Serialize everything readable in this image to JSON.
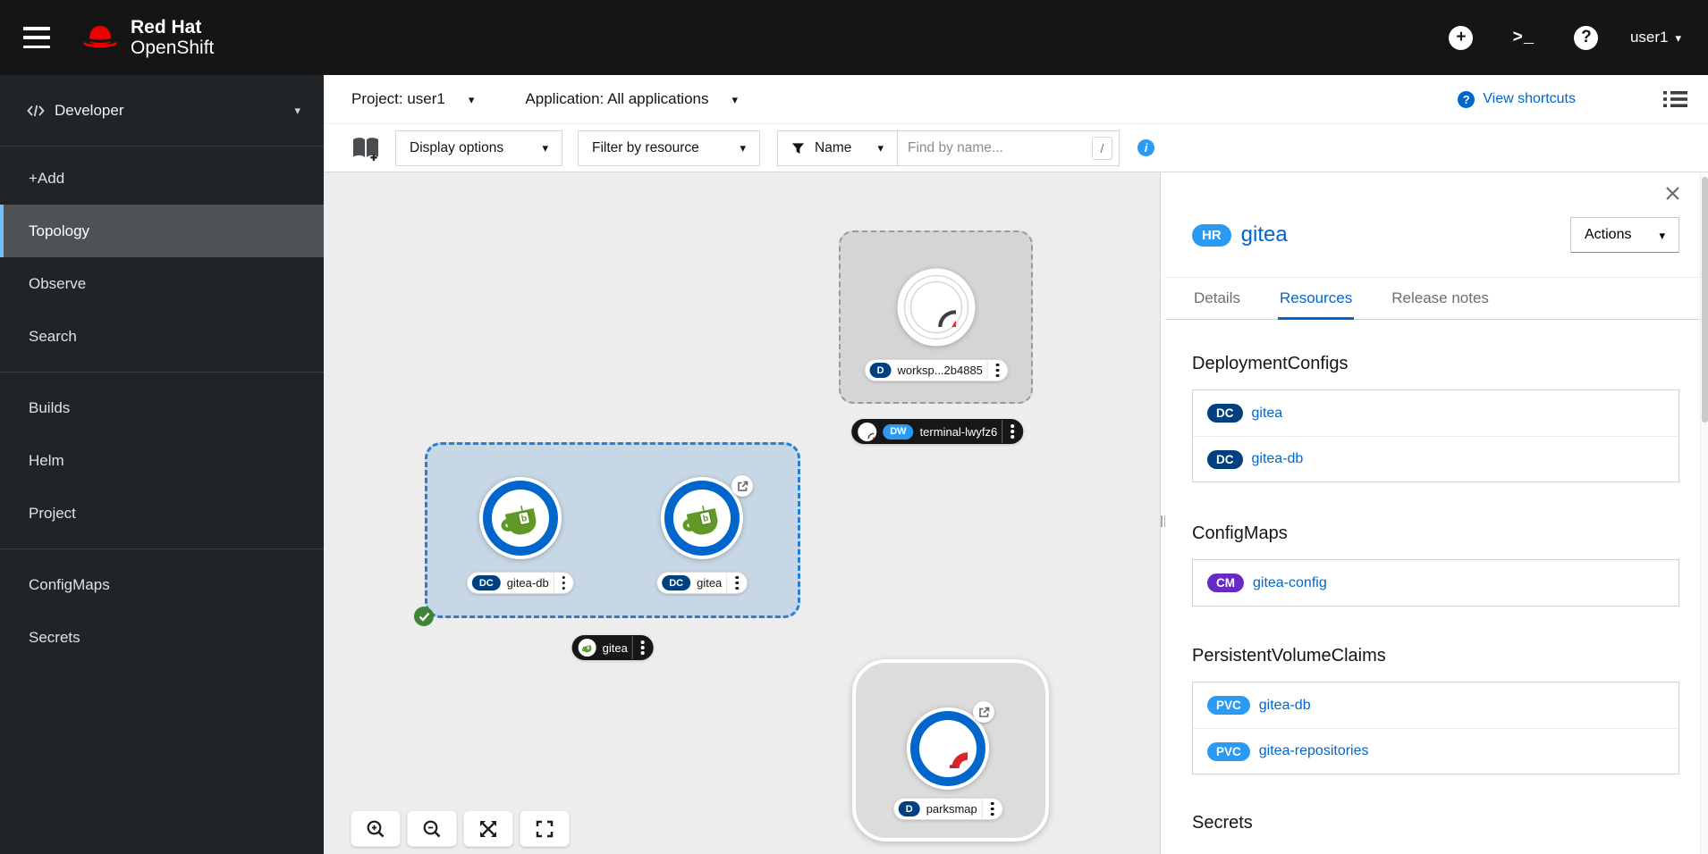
{
  "masthead": {
    "brand_top": "Red Hat",
    "brand_bottom": "OpenShift",
    "user_menu": "user1"
  },
  "sidenav": {
    "perspective": "Developer",
    "items": [
      "+Add",
      "Topology",
      "Observe",
      "Search",
      "Builds",
      "Helm",
      "Project",
      "ConfigMaps",
      "Secrets"
    ],
    "active_item": "Topology"
  },
  "toolbar": {
    "project": "Project: user1",
    "application": "Application: All applications",
    "view_shortcuts": "View shortcuts"
  },
  "filterbar": {
    "display_options": "Display options",
    "filter_by_resource": "Filter by resource",
    "name_filter": "Name",
    "find_placeholder": "Find by name...",
    "slash_hint": "/"
  },
  "canvas": {
    "workspace_node": {
      "badge": "D",
      "name": "worksp...2b4885"
    },
    "terminal_pill": {
      "badge": "DW",
      "name": "terminal-lwyfz6"
    },
    "app_group": {
      "nodes": [
        {
          "badge": "DC",
          "name": "gitea-db"
        },
        {
          "badge": "DC",
          "name": "gitea"
        }
      ],
      "app_pill": {
        "name": "gitea"
      }
    },
    "parksmap_node": {
      "badge": "D",
      "name": "parksmap"
    }
  },
  "panel": {
    "resource_badge": "HR",
    "title": "gitea",
    "actions": "Actions",
    "tabs": [
      "Details",
      "Resources",
      "Release notes"
    ],
    "active_tab": "Resources",
    "sections": [
      {
        "heading": "DeploymentConfigs",
        "items": [
          {
            "badge": "DC",
            "name": "gitea"
          },
          {
            "badge": "DC",
            "name": "gitea-db"
          }
        ]
      },
      {
        "heading": "ConfigMaps",
        "items": [
          {
            "badge": "CM",
            "name": "gitea-config"
          }
        ]
      },
      {
        "heading": "PersistentVolumeClaims",
        "items": [
          {
            "badge": "PVC",
            "name": "gitea-db"
          },
          {
            "badge": "PVC",
            "name": "gitea-repositories"
          }
        ]
      },
      {
        "heading": "Secrets",
        "items": []
      }
    ]
  },
  "icons": {
    "plus": "+",
    "terminal": ">_",
    "help": "?",
    "question": "?",
    "info": "i",
    "caret_down": "▾"
  },
  "colors": {
    "masthead_bg": "#151515",
    "nav_bg": "#212427",
    "nav_selected_bg": "#4f5255",
    "nav_selected_border": "#73bcf7",
    "link_blue": "#0066cc",
    "light_blue_badge": "#2b9af3",
    "navy_badge": "#004080",
    "purple_badge": "#6929c4",
    "brand_red": "#ee0000",
    "canvas_bg": "#ededed",
    "selection_blue": "#2b7cd3",
    "success_green": "#3e8635",
    "gitea_green": "#609926",
    "openshift_red": "#da2430"
  }
}
